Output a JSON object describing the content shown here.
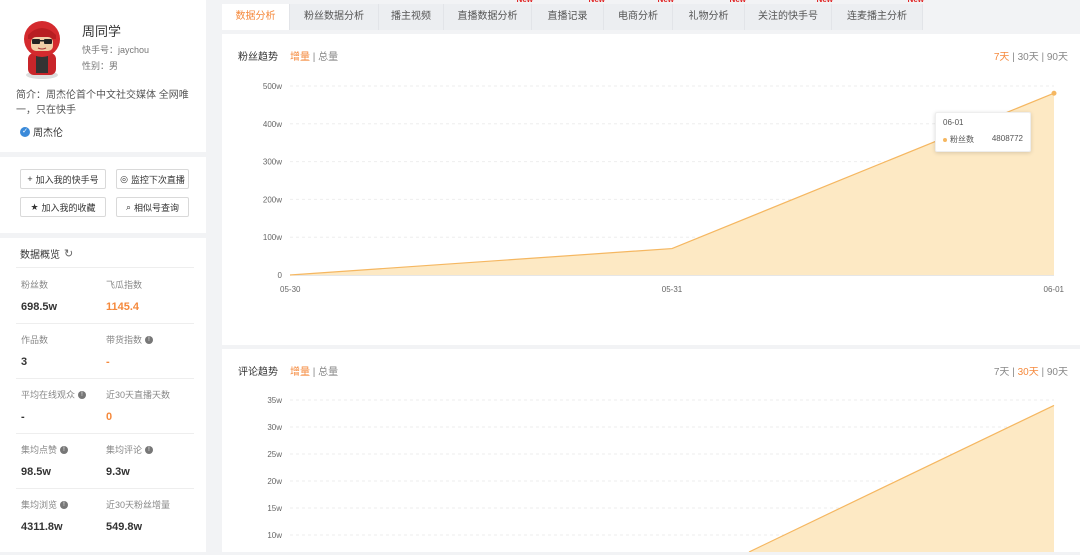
{
  "profile": {
    "name": "周同学",
    "account": "快手号：jaychou",
    "gender": "性别：男",
    "bio": "简介：周杰伦首个中文社交媒体 全网唯一，只在快手",
    "verified": "周杰伦"
  },
  "actions": {
    "add_account": "加入我的快手号",
    "monitor_live": "监控下次直播",
    "add_favorite": "加入我的收藏",
    "similar_search": "相似号查询"
  },
  "overview": {
    "title": "数据概览",
    "stats": [
      {
        "label": "粉丝数",
        "value": "698.5w",
        "info": false
      },
      {
        "label": "飞瓜指数",
        "value": "1145.4",
        "info": false
      },
      {
        "label": "作品数",
        "value": "3",
        "info": false
      },
      {
        "label": "带货指数",
        "value": "-",
        "info": true
      },
      {
        "label": "平均在线观众",
        "value": "-",
        "info": true
      },
      {
        "label": "近30天直播天数",
        "value": "0",
        "info": false
      },
      {
        "label": "集均点赞",
        "value": "98.5w",
        "info": true
      },
      {
        "label": "集均评论",
        "value": "9.3w",
        "info": true
      },
      {
        "label": "集均浏览",
        "value": "4311.8w",
        "info": true
      },
      {
        "label": "近30天粉丝增量",
        "value": "549.8w",
        "info": false
      }
    ]
  },
  "tabs": [
    {
      "label": "数据分析",
      "new": ""
    },
    {
      "label": "粉丝数据分析",
      "new": ""
    },
    {
      "label": "播主视频",
      "new": ""
    },
    {
      "label": "直播数据分析",
      "new": "New"
    },
    {
      "label": "直播记录",
      "new": "New"
    },
    {
      "label": "电商分析",
      "new": "New"
    },
    {
      "label": "礼物分析",
      "new": "New"
    },
    {
      "label": "关注的快手号",
      "new": "New"
    },
    {
      "label": "连麦播主分析",
      "new": "New"
    }
  ],
  "panel1": {
    "title": "粉丝趋势",
    "mode_on": "增量",
    "mode_sep": "|",
    "mode_off": "总量",
    "ranges": [
      "7天",
      "30天",
      "90天"
    ],
    "tooltip": {
      "date": "06-01",
      "label": "粉丝数",
      "value": "4808772"
    }
  },
  "panel2": {
    "title": "评论趋势",
    "mode_on": "增量",
    "mode_sep": "|",
    "mode_off": "总量",
    "ranges": [
      "7天",
      "30天",
      "90天"
    ]
  },
  "colors": {
    "accent": "#f5893c",
    "area": "#fde9c4",
    "line": "#f5b761",
    "new_badge": "#e02020"
  },
  "chart_data": [
    {
      "type": "area",
      "x": [
        "05-30",
        "05-31",
        "06-01"
      ],
      "values": [
        0,
        700000,
        4808772
      ],
      "y_ticks": [
        "0",
        "100w",
        "200w",
        "300w",
        "400w",
        "500w"
      ],
      "ylim": [
        0,
        5000000
      ],
      "grid": true
    },
    {
      "type": "area",
      "y_ticks": [
        "10w",
        "15w",
        "20w",
        "25w",
        "30w",
        "35w"
      ],
      "ylim": [
        0,
        350000
      ],
      "grid": true,
      "visible_end_value": 340000
    }
  ]
}
